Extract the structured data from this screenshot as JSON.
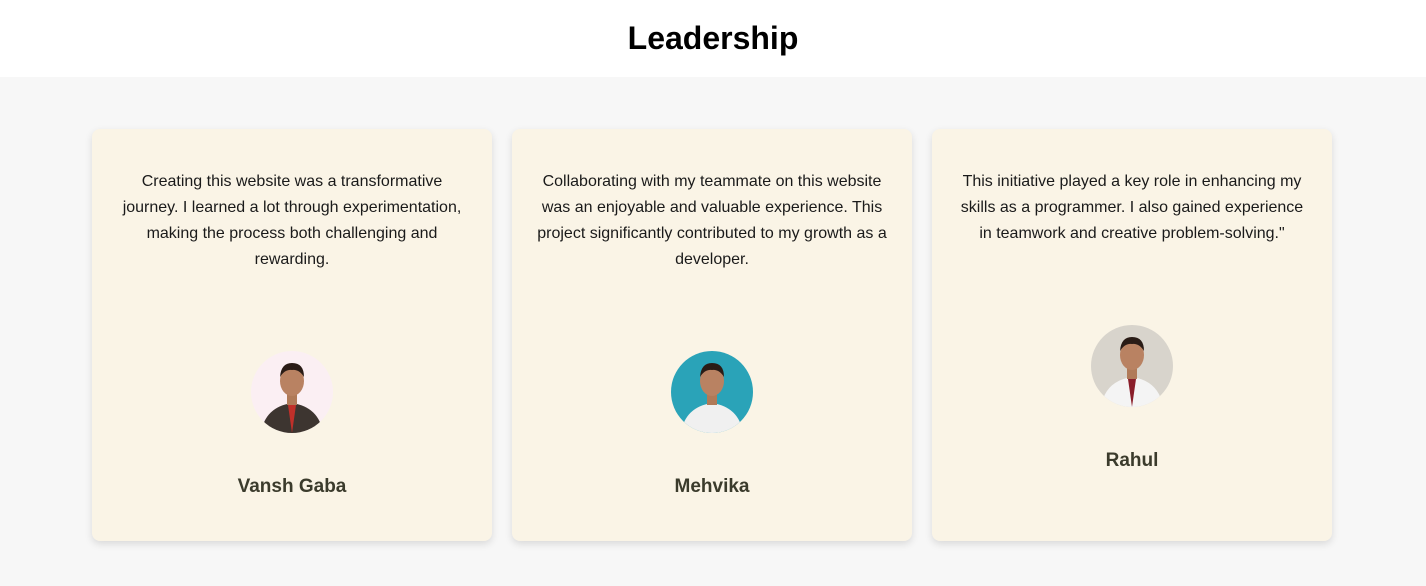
{
  "header": {
    "title": "Leadership"
  },
  "leaders": [
    {
      "quote": "Creating this website was a transformative journey. I learned a lot through experimentation, making the process both challenging and rewarding.",
      "name": "Vansh Gaba",
      "avatar_bg": "#fbeff3",
      "shirt": "#3d3530",
      "tie": "#c0302a"
    },
    {
      "quote": "Collaborating with my teammate on this website was an enjoyable and valuable experience. This project significantly contributed to my growth as a developer.",
      "name": "Mehvika",
      "avatar_bg": "#2aa3b8",
      "shirt": "#f0f0f0",
      "tie": "#f0f0f0"
    },
    {
      "quote": "This initiative played a key role in enhancing my skills as a programmer. I also gained experience in teamwork and creative problem-solving.\"",
      "name": "Rahul",
      "avatar_bg": "#d8d4cc",
      "shirt": "#f4f4f4",
      "tie": "#8a1e2a"
    }
  ]
}
